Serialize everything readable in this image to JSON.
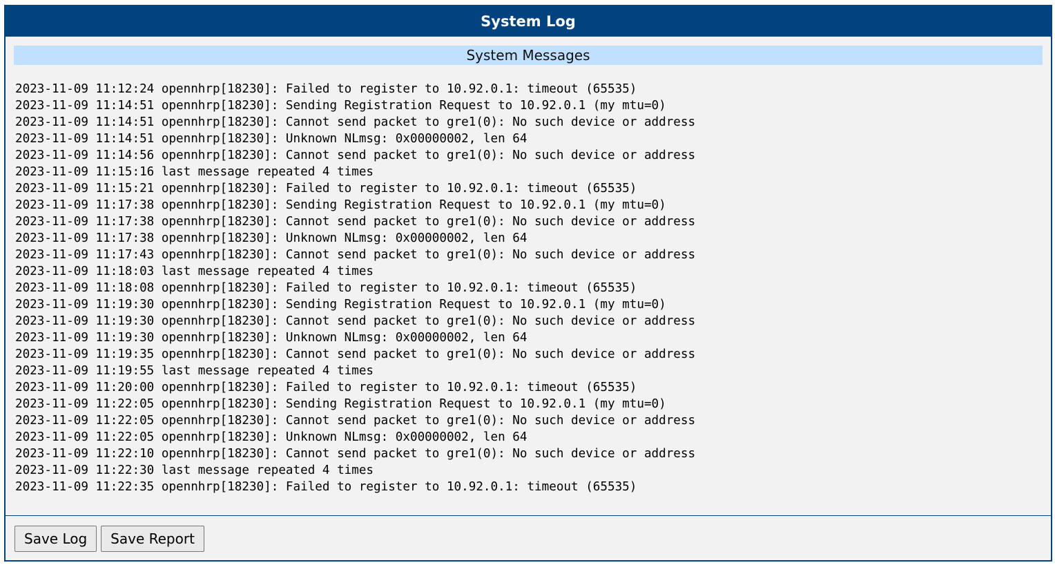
{
  "window": {
    "title": "System Log"
  },
  "section": {
    "title": "System Messages"
  },
  "log": {
    "lines": [
      "2023-11-09 11:12:24 opennhrp[18230]: Failed to register to 10.92.0.1: timeout (65535)",
      "2023-11-09 11:14:51 opennhrp[18230]: Sending Registration Request to 10.92.0.1 (my mtu=0)",
      "2023-11-09 11:14:51 opennhrp[18230]: Cannot send packet to gre1(0): No such device or address",
      "2023-11-09 11:14:51 opennhrp[18230]: Unknown NLmsg: 0x00000002, len 64",
      "2023-11-09 11:14:56 opennhrp[18230]: Cannot send packet to gre1(0): No such device or address",
      "2023-11-09 11:15:16 last message repeated 4 times",
      "2023-11-09 11:15:21 opennhrp[18230]: Failed to register to 10.92.0.1: timeout (65535)",
      "2023-11-09 11:17:38 opennhrp[18230]: Sending Registration Request to 10.92.0.1 (my mtu=0)",
      "2023-11-09 11:17:38 opennhrp[18230]: Cannot send packet to gre1(0): No such device or address",
      "2023-11-09 11:17:38 opennhrp[18230]: Unknown NLmsg: 0x00000002, len 64",
      "2023-11-09 11:17:43 opennhrp[18230]: Cannot send packet to gre1(0): No such device or address",
      "2023-11-09 11:18:03 last message repeated 4 times",
      "2023-11-09 11:18:08 opennhrp[18230]: Failed to register to 10.92.0.1: timeout (65535)",
      "2023-11-09 11:19:30 opennhrp[18230]: Sending Registration Request to 10.92.0.1 (my mtu=0)",
      "2023-11-09 11:19:30 opennhrp[18230]: Cannot send packet to gre1(0): No such device or address",
      "2023-11-09 11:19:30 opennhrp[18230]: Unknown NLmsg: 0x00000002, len 64",
      "2023-11-09 11:19:35 opennhrp[18230]: Cannot send packet to gre1(0): No such device or address",
      "2023-11-09 11:19:55 last message repeated 4 times",
      "2023-11-09 11:20:00 opennhrp[18230]: Failed to register to 10.92.0.1: timeout (65535)",
      "2023-11-09 11:22:05 opennhrp[18230]: Sending Registration Request to 10.92.0.1 (my mtu=0)",
      "2023-11-09 11:22:05 opennhrp[18230]: Cannot send packet to gre1(0): No such device or address",
      "2023-11-09 11:22:05 opennhrp[18230]: Unknown NLmsg: 0x00000002, len 64",
      "2023-11-09 11:22:10 opennhrp[18230]: Cannot send packet to gre1(0): No such device or address",
      "2023-11-09 11:22:30 last message repeated 4 times",
      "2023-11-09 11:22:35 opennhrp[18230]: Failed to register to 10.92.0.1: timeout (65535)"
    ]
  },
  "buttons": {
    "save_log": "Save Log",
    "save_report": "Save Report"
  },
  "colors": {
    "brand": "#00437f",
    "section_header": "#bfe0ff",
    "panel_background": "#f2f2f2"
  }
}
